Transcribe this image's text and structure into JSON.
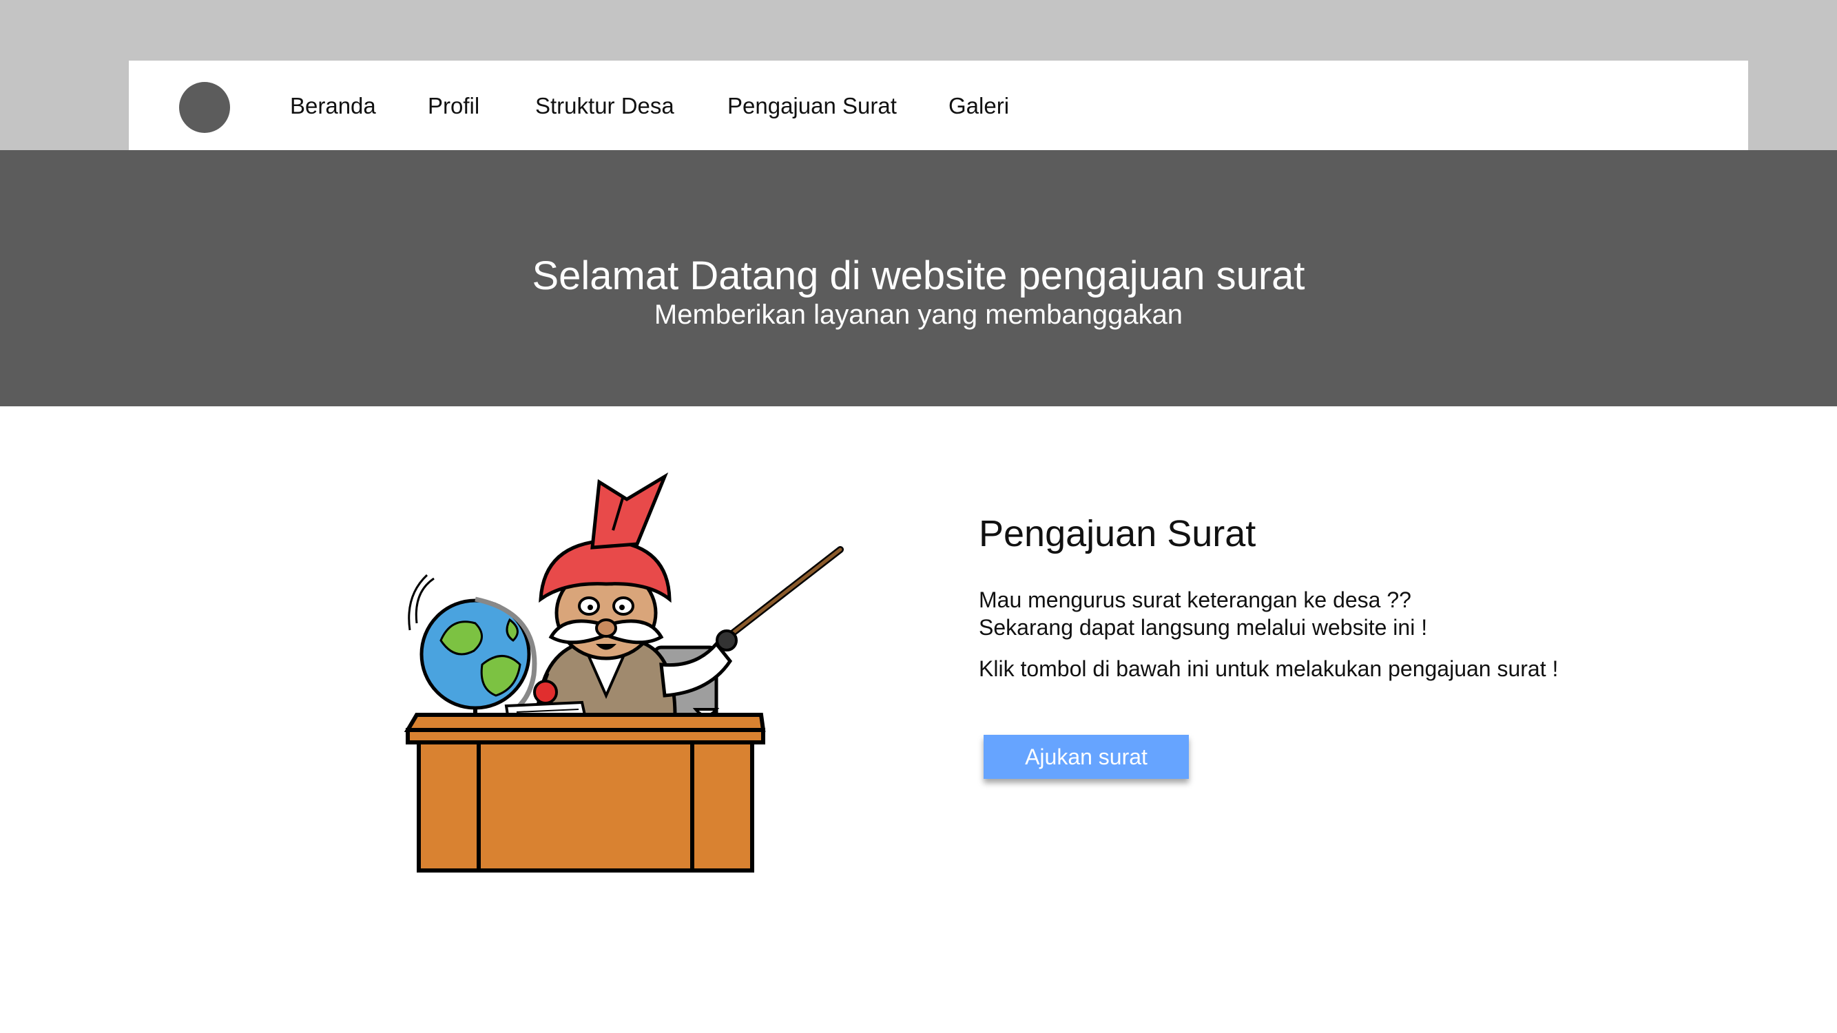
{
  "nav": {
    "items": [
      {
        "label": "Beranda"
      },
      {
        "label": "Profil"
      },
      {
        "label": "Struktur Desa"
      },
      {
        "label": "Pengajuan Surat"
      },
      {
        "label": "Galeri"
      }
    ]
  },
  "hero": {
    "title": "Selamat Datang di website pengajuan surat",
    "subtitle": "Memberikan layanan yang membanggakan"
  },
  "content": {
    "title": "Pengajuan Surat",
    "line1": "Mau mengurus surat keterangan ke desa ??",
    "line2": "Sekarang dapat langsung melalui website ini !",
    "line3": "Klik tombol di bawah ini untuk melakukan pengajuan surat !",
    "button_label": "Ajukan surat"
  },
  "colors": {
    "top_band": "#c4c4c4",
    "hero_background": "#5c5c5c",
    "button": "#66a4ff",
    "logo": "#5c5c5c"
  },
  "icons": {
    "logo": "circle-logo-icon",
    "illustration": "teacher-at-desk-illustration"
  }
}
